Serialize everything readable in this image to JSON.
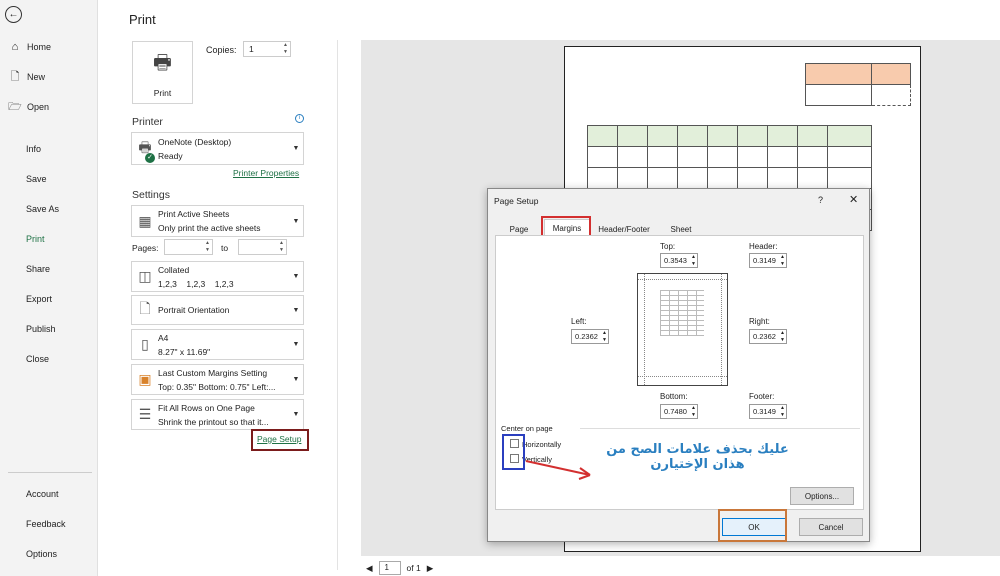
{
  "nav": {
    "back_icon": "arrow-left-icon",
    "items": [
      "Home",
      "New",
      "Open",
      "Info",
      "Save",
      "Save As",
      "Print",
      "Share",
      "Export",
      "Publish",
      "Close",
      "Account",
      "Feedback",
      "Options"
    ]
  },
  "print": {
    "title": "Print",
    "print_button": "Print",
    "copies_label": "Copies:",
    "copies_value": "1",
    "printer_section": "Printer",
    "printer_name": "OneNote (Desktop)",
    "printer_status": "Ready",
    "printer_properties": "Printer Properties",
    "settings_section": "Settings",
    "active_sheets": "Print Active Sheets",
    "active_sheets_sub": "Only print the active sheets",
    "pages_label": "Pages:",
    "pages_to": "to",
    "collated": "Collated",
    "collated_sub": "1,2,3    1,2,3    1,2,3",
    "orientation": "Portrait Orientation",
    "paper": "A4",
    "paper_sub": "8.27\" x 11.69\"",
    "margins": "Last Custom Margins Setting",
    "margins_sub": "Top: 0.35\" Bottom: 0.75\" Left:...",
    "scaling": "Fit All Rows on One Page",
    "scaling_sub": "Shrink the printout so that it...",
    "page_setup_link": "Page Setup"
  },
  "pager": {
    "page": "1",
    "of": "of 1"
  },
  "dialog": {
    "title": "Page Setup",
    "help": "?",
    "close": "✕",
    "tabs": [
      "Page",
      "Margins",
      "Header/Footer",
      "Sheet"
    ],
    "top_label": "Top:",
    "top_value": "0.3543",
    "header_label": "Header:",
    "header_value": "0.3149",
    "left_label": "Left:",
    "left_value": "0.2362",
    "right_label": "Right:",
    "right_value": "0.2362",
    "bottom_label": "Bottom:",
    "bottom_value": "0.7480",
    "footer_label": "Footer:",
    "footer_value": "0.3149",
    "center_label": "Center on page",
    "horizontally": "Horizontally",
    "vertically": "Vertically",
    "options": "Options...",
    "ok": "OK",
    "cancel": "Cancel"
  },
  "annotation": {
    "line1": "عليك بحذف علامات الصح من",
    "line2": "هذان الإختيارن"
  },
  "colors": {
    "accent": "#1e7145",
    "header_fill": "#f8cbad",
    "green_fill": "#e2efda",
    "red_box": "#d32f2f",
    "maroon_box": "#7b1c1c",
    "blue_box": "#2b3fbf",
    "orange_box": "#c9773a"
  }
}
